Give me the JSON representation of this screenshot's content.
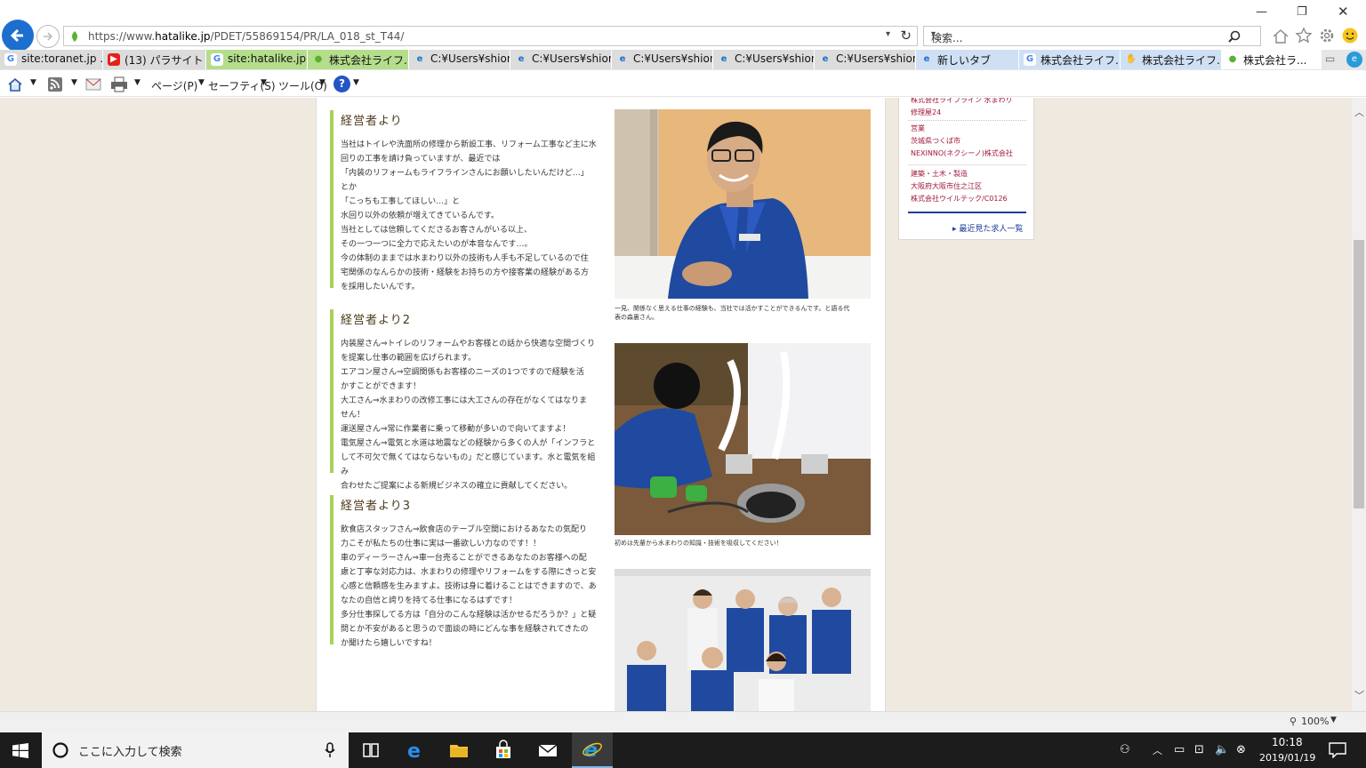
{
  "browser": {
    "url_prefix": "https://www.",
    "url_domain": "hatalike.jp",
    "url_path": "/PDET/55869154/PR/LA_018_st_T44/",
    "search_placeholder": "検索...",
    "tabs": [
      {
        "label": "site:toranet.jp ...",
        "icon": "google-icon",
        "style": "grey"
      },
      {
        "label": "(13) パラサイト イ...",
        "icon": "youtube-icon",
        "style": "grey"
      },
      {
        "label": "site:hatalike.jp ...",
        "icon": "google-icon",
        "style": "green"
      },
      {
        "label": "株式会社ライフ...",
        "icon": "hatalike-icon",
        "style": "green"
      },
      {
        "label": "C:¥Users¥shion...",
        "icon": "ie-icon",
        "style": "grey"
      },
      {
        "label": "C:¥Users¥shion...",
        "icon": "ie-icon",
        "style": "grey"
      },
      {
        "label": "C:¥Users¥shion...",
        "icon": "ie-icon",
        "style": "grey"
      },
      {
        "label": "C:¥Users¥shion...",
        "icon": "ie-icon",
        "style": "grey"
      },
      {
        "label": "C:¥Users¥shion...",
        "icon": "ie-icon",
        "style": "grey"
      },
      {
        "label": "新しいタブ",
        "icon": "ie-icon",
        "style": "blue"
      },
      {
        "label": "株式会社ライフ...",
        "icon": "google-icon",
        "style": "blue"
      },
      {
        "label": "株式会社ライフ...",
        "icon": "hand-icon",
        "style": "blue"
      },
      {
        "label": "株式会社ラ...",
        "icon": "hatalike-icon",
        "style": "white"
      }
    ],
    "commands": {
      "page": "ページ(P)",
      "safety": "セーフティ(S)",
      "tools": "ツール(O)"
    }
  },
  "article": {
    "sections": [
      {
        "title": "経営者より",
        "body": "当社はトイレや洗面所の修理から新設工事、リフォーム工事など主に水\n回りの工事を請け負っていますが、最近では\n「内装のリフォームもライフラインさんにお願いしたいんだけど…」\nとか\n「こっちも工事してほしい…」と\n水回り以外の依頼が増えてきているんです。\n当社としては信頼してくださるお客さんがいる以上、\nその一つ一つに全力で応えたいのが本音なんです…。\n今の体制のままでは水まわり以外の技術も人手も不足しているので住\n宅関係のなんらかの技術・経験をお持ちの方や接客業の経験がある方\nを採用したいんです。"
      },
      {
        "title": "経営者より2",
        "body": "内装屋さん⇒トイレのリフォームやお客様との話から快適な空間づくり\nを提案し仕事の範囲を広げられます。\nエアコン屋さん⇒空調関係もお客様のニーズの1つですので経験を活\nかすことができます！\n大工さん⇒水まわりの改修工事には大工さんの存在がなくてはなりま\nせん！\n運送屋さん⇒常に作業者に乗って移動が多いので向いてますよ！\n電気屋さん⇒電気と水道は地震などの経験から多くの人が「インフラと\nして不可欠で無くてはならないもの」だと感じています。水と電気を組み\n合わせたご提案による新規ビジネスの確立に貢献してください。"
      },
      {
        "title": "経営者より3",
        "body": "飲食店スタッフさん⇒飲食店のテーブル空間におけるあなたの気配り\n力こそが私たちの仕事に実は一番欲しい力なのです！！\n車のディーラーさん⇒車一台売ることができるあなたのお客様への配\n慮と丁寧な対応力は、水まわりの修理やリフォームをする際にきっと安\n心感と信頼感を生みますよ。技術は身に着けることはできますので、あ\nなたの自信と誇りを持てる仕事になるはずです！\n多分仕事探してる方は「自分のこんな経験は活かせるだろうか？」と疑\n問とか不安があると思うので面談の時にどんな事を経験されてきたの\nか聞けたら嬉しいですね！"
      }
    ],
    "captions": [
      "一見、関係なく思える仕事の経験も、当社では活かすことができるんです。と語る代\n表の森裏さん。",
      "初めは先輩から水まわりの知識・技術を吸収してください！"
    ]
  },
  "sidebar": {
    "block1": "株式会社ライフライン 水まわり\n修理屋24",
    "block2": "営業\n茨城県つくば市\nNEXINNO(ネクシーノ)株式会社",
    "block3": "建築・土木・製造\n大阪府大阪市住之江区\n株式会社ウイルテック/C0126",
    "recent_link": "最近見た求人一覧"
  },
  "status": {
    "zoom": "100%"
  },
  "taskbar": {
    "search_placeholder": "ここに入力して検索",
    "time": "10:18",
    "date": "2019/01/19"
  },
  "colors": {
    "accent_green": "#a9d157",
    "sidebar_red": "#a01a3a",
    "link_blue": "#1a3c9a",
    "page_bg": "#efe9df"
  }
}
